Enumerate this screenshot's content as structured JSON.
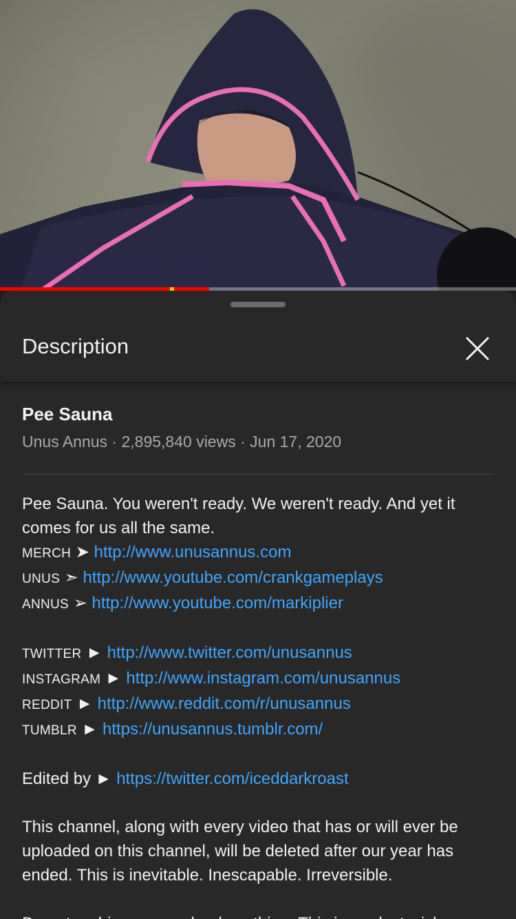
{
  "player": {
    "progress_played_pct": 40.5,
    "progress_buffered_pct": 40.5,
    "colors": {
      "played": "#ff0000",
      "chapter_marker": "#ffcc00"
    }
  },
  "sheet": {
    "title": "Description",
    "close_icon": "close-icon"
  },
  "video": {
    "title": "Pee Sauna",
    "channel": "Unus Annus",
    "separator": "·",
    "views": "2,895,840 views",
    "date": "Jun 17, 2020"
  },
  "description": {
    "intro_line1": "Pee Sauna. You weren't ready. We weren't ready. And yet it",
    "intro_line2": "comes for us all the same.",
    "links_a": [
      {
        "label": "MERCH",
        "arrow": "➤",
        "url": "http://www.unusannus.com"
      },
      {
        "label": "UNUS",
        "arrow": "➣",
        "url": "http://www.youtube.com/crankgameplays"
      },
      {
        "label": "ANNUS",
        "arrow": "➢",
        "url": "http://www.youtube.com/markiplier"
      }
    ],
    "links_b": [
      {
        "label": "TWITTER",
        "arrow": "►",
        "url": "http://www.twitter.com/unusannus"
      },
      {
        "label": "INSTAGRAM",
        "arrow": "►",
        "url": "http://www.instagram.com/unusannus"
      },
      {
        "label": "REDDIT",
        "arrow": "►",
        "url": "http://www.reddit.com/r/unusannus"
      },
      {
        "label": "TUMBLR",
        "arrow": "►",
        "url": "https://unusannus.tumblr.com/"
      }
    ],
    "edited_label": "Edited by",
    "edited_arrow": "►",
    "edited_url": "https://twitter.com/iceddarkroast",
    "para1_line1": "This channel, along with every video that has or will ever be",
    "para1_line2": "uploaded on this channel, will be deleted after our year has",
    "para1_line3": "ended. This is inevitable. Inescapable. Irreversible.",
    "para2_line1": "Do not archive or re-upload anything. This is our last wish."
  }
}
